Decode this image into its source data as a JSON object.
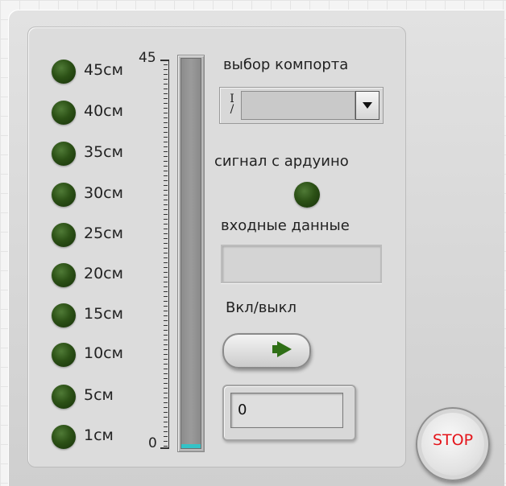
{
  "leds": {
    "labels": [
      "45см",
      "40см",
      "35см",
      "30см",
      "25см",
      "20см",
      "15см",
      "10см",
      "5см",
      "1см"
    ]
  },
  "scale": {
    "max_label": "45",
    "min_label": "0",
    "level_fraction": 0.01
  },
  "comport": {
    "label": "выбор компорта",
    "io_symbol": "I/O",
    "value": ""
  },
  "signal": {
    "label": "сигнал с ардуино"
  },
  "input_data": {
    "label": "входные данные",
    "value": ""
  },
  "power": {
    "label": "Вкл/выкл"
  },
  "numeric": {
    "value": "0"
  },
  "stop": {
    "label": "STOP"
  },
  "colors": {
    "led_off": "#2c5116",
    "tank_fill": "#34c3c7",
    "stop_text": "#e4141a"
  }
}
